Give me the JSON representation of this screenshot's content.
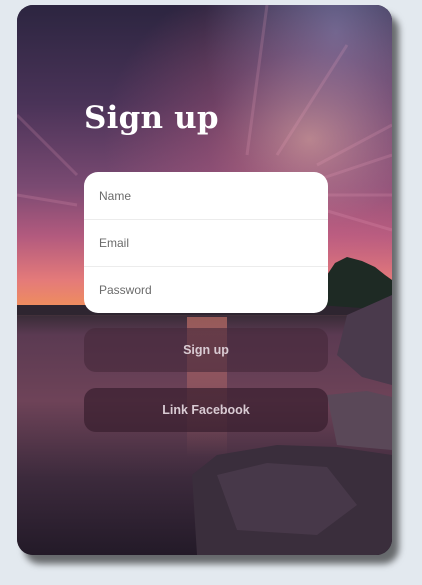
{
  "form": {
    "title": "Sign up",
    "name_placeholder": "Name",
    "email_placeholder": "Email",
    "password_placeholder": "Password",
    "signup_label": "Sign up",
    "facebook_label": "Link Facebook"
  },
  "colors": {
    "page_background": "#e3e9ef",
    "card_dark": "#2a1f33",
    "sunset_pink": "#e0708a",
    "sunset_orange": "#f08a5a",
    "button_text": "#d9cbd3"
  }
}
